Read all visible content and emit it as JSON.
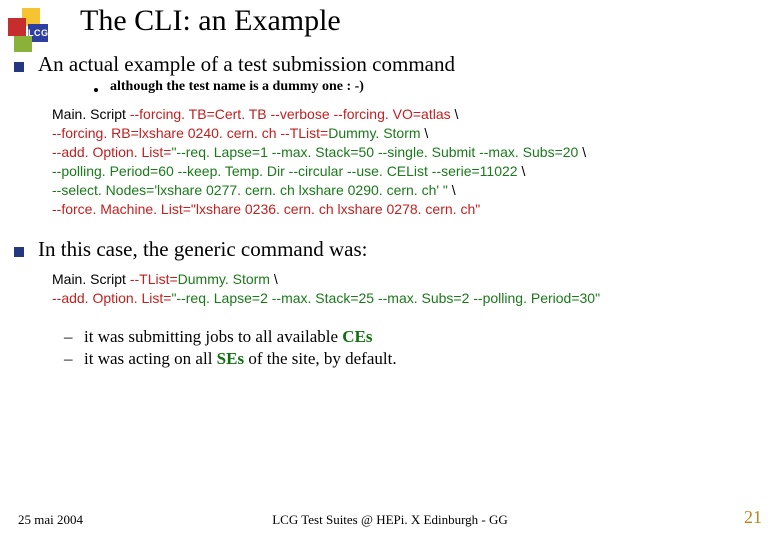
{
  "logo": {
    "text": "LCG"
  },
  "title": "The CLI: an Example",
  "section1": {
    "heading": "An actual example of a test submission command",
    "sub": "although the test name is a dummy one : -)",
    "code": {
      "l1a": "Main. Script ",
      "l1b": "--forcing. TB=Cert. TB --verbose --forcing. VO=atlas",
      "l1c": " \\",
      "l2a": "--forcing. RB=lxshare 0240. cern. ch --TList=",
      "l2b": "Dummy. Storm",
      "l2c": " \\",
      "l3a": "--add. Option. List=",
      "l3b": "\"--req. Lapse=1 --max. Stack=50 --single. Submit --max. Subs=20",
      "l3c": " \\",
      "l4a": "--polling. Period=60 --keep. Temp. Dir --circular --use. CEList --serie=11022",
      "l4b": " \\",
      "l5a": "--select. Nodes='lxshare 0277. cern. ch lxshare 0290. cern. ch' \"",
      "l5b": "  \\",
      "l6a": "--force. Machine. List=\"lxshare 0236. cern. ch lxshare 0278. cern. ch\""
    }
  },
  "section2": {
    "heading": "In this case, the generic command was:",
    "code": {
      "l1a": "Main. Script ",
      "l1b": "--TList=",
      "l1c": "Dummy. Storm",
      "l1d": " \\",
      "l2a": "--add. Option. List=",
      "l2b": "\"--req. Lapse=2 --max. Stack=25 --max. Subs=2 --polling. Period=30\""
    },
    "dash1a": "it was submitting jobs to all available ",
    "dash1b": "CEs",
    "dash2a": "it was acting on all ",
    "dash2b": "SEs",
    "dash2c": " of the site, by default."
  },
  "footer": {
    "left": "25 mai 2004",
    "center": "LCG Test Suites @ HEPi. X Edinburgh - GG",
    "right": "21"
  }
}
